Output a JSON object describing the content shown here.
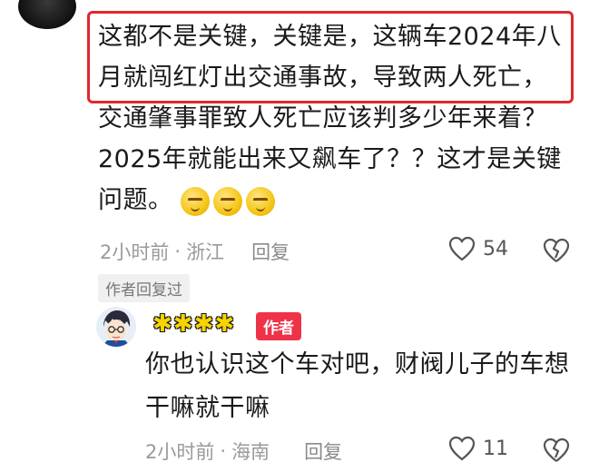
{
  "comment": {
    "lines": [
      "这都不是关键，关键是，这辆车2024年八",
      "月就闯红灯出交通事故，导致两人死亡，",
      "交通肇事罪致人死亡应该判多少年来着？",
      "2025年就能出来又飙车了？？这才是关键",
      "问题。"
    ],
    "emojis": [
      "thinking-emoji",
      "thinking-emoji",
      "thinking-emoji"
    ],
    "time": "2小时前",
    "dot": "·",
    "location": "浙江",
    "reply_label": "回复",
    "like_count": "54",
    "highlight_color": "#e0282e"
  },
  "author_replied_tag": "作者回复过",
  "reply": {
    "name": "✱✱✱✱",
    "author_badge": "作者",
    "lines": [
      "你也认识这个车对吧，财阀儿子的车想",
      "干嘛就干嘛"
    ],
    "time": "2小时前",
    "dot": "·",
    "location": "海南",
    "reply_label": "回复",
    "like_count": "11",
    "badge_color": "#ee3349"
  }
}
